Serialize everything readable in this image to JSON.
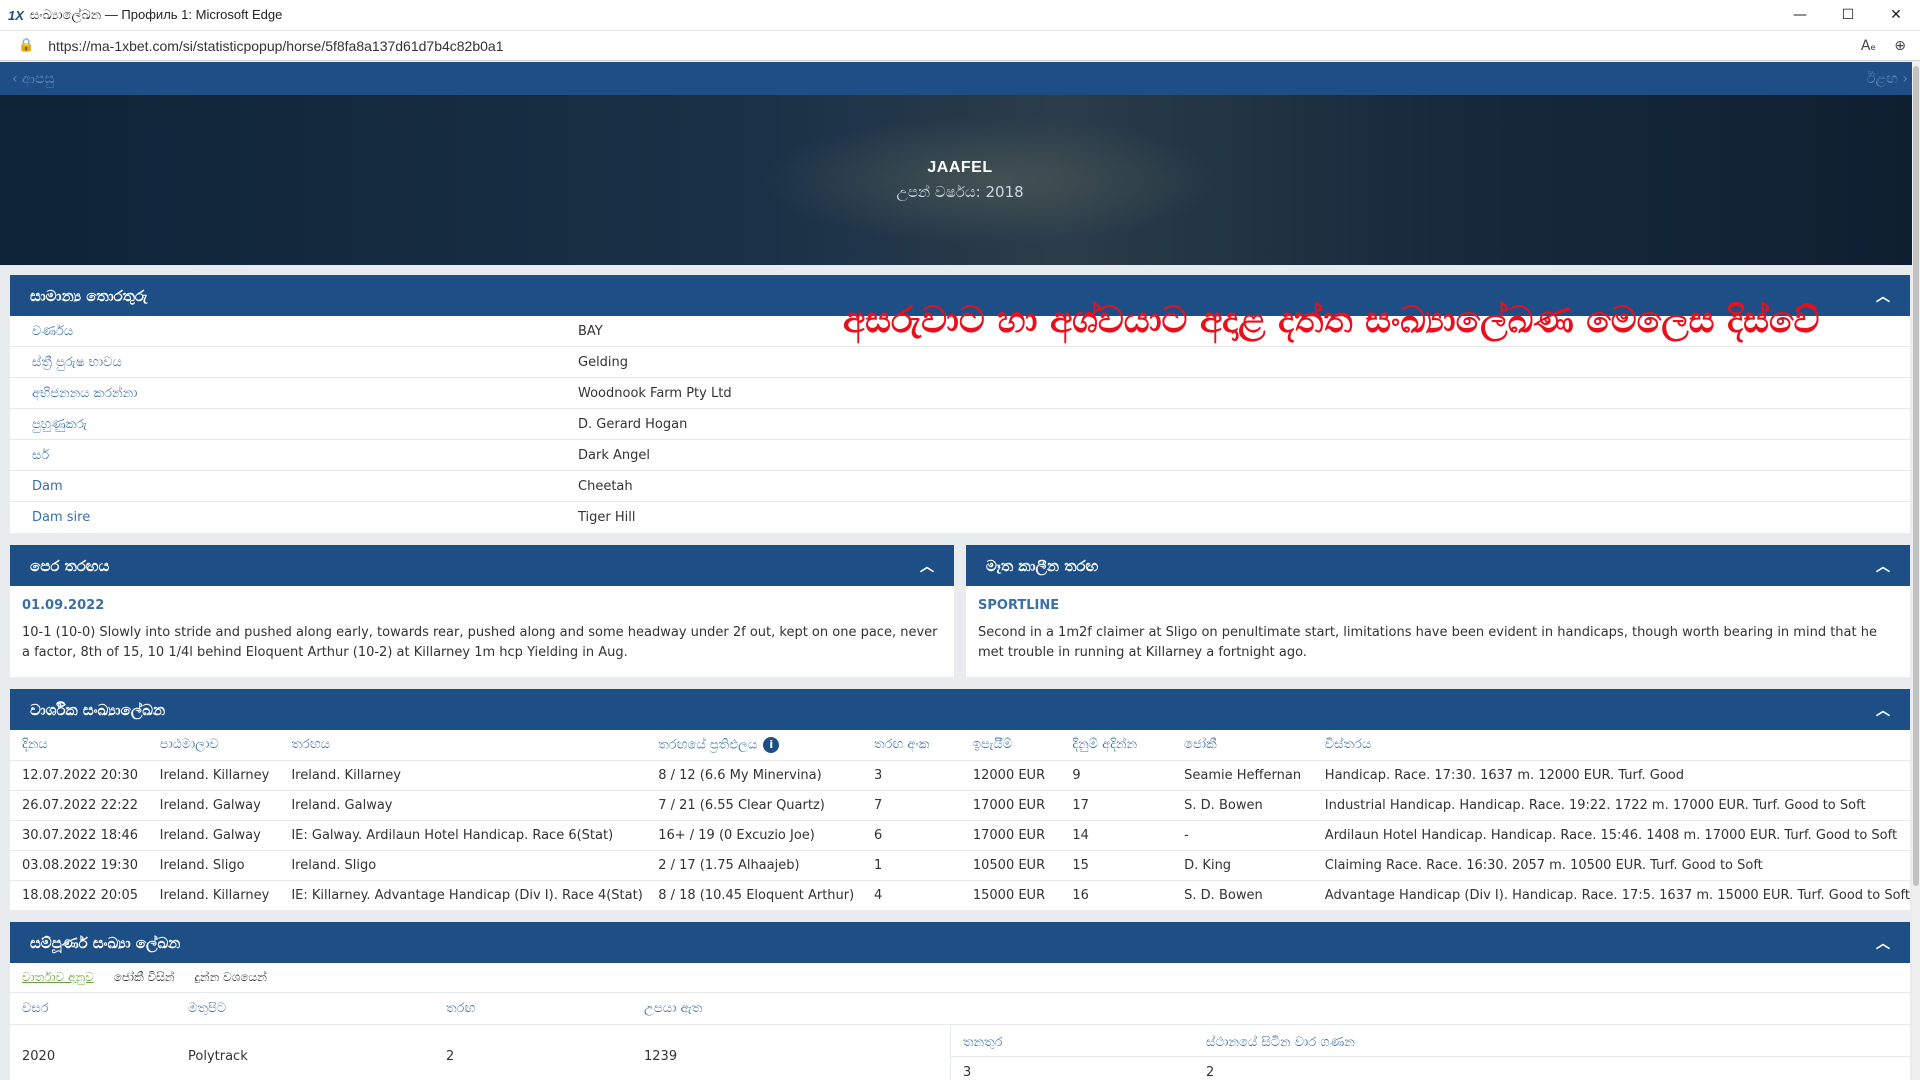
{
  "window": {
    "favicon": "1X",
    "title": "සංඛ්‍යාලේඛන — Профиль 1: Microsoft Edge",
    "controls": {
      "minimize": "—",
      "maximize": "☐",
      "close": "✕"
    }
  },
  "address_bar": {
    "url": "https://ma-1xbet.com/si/statisticpopup/horse/5f8fa8a137d61d7b4c82b0a1",
    "read_aloud": "Aₑ",
    "zoom": "⊕"
  },
  "nav": {
    "back": "‹ ආපසු",
    "forward": "ඊළඟ ›"
  },
  "hero": {
    "horse_name": "JAAFEL",
    "birth_year": "උපන් වර්ෂය: 2018"
  },
  "general": {
    "title": "සාමාන්‍ය තොරතුරු",
    "rows": [
      {
        "key": "වර්ණය",
        "value": "BAY"
      },
      {
        "key": "ස්ත්‍රී පුරුෂ භාවය",
        "value": "Gelding"
      },
      {
        "key": "අභිජනනය කරන්නා",
        "value": "Woodnook Farm Pty Ltd"
      },
      {
        "key": "පුහුණුකරු",
        "value": "D. Gerard Hogan"
      },
      {
        "key": "සර්",
        "value": "Dark Angel"
      },
      {
        "key": "Dam",
        "value": "Cheetah"
      },
      {
        "key": "Dam sire",
        "value": "Tiger Hill"
      }
    ]
  },
  "previous_race": {
    "title": "පෙර තරඟය",
    "date": "01.09.2022",
    "text": "10-1 (10-0) Slowly into stride and pushed along early, towards rear, pushed along and some headway under 2f out, kept on one pace, never a factor, 8th of 15, 10 1/4l behind Eloquent Arthur (10-2) at Killarney 1m hcp Yielding in Aug."
  },
  "recent_races": {
    "title": "මෑත කාලීන තරඟ",
    "source": "SPORTLINE",
    "text": "Second in a 1m2f claimer at Sligo on penultimate start, limitations have been evident in handicaps, though worth bearing in mind that he met trouble in running at Killarney a fortnight ago."
  },
  "annual": {
    "title": "වාර්ශික සංඛ්‍යාලේඛන",
    "headers": [
      "දිනය",
      "පාඨමාලාව",
      "තරඟය",
      "තරඟයේ ප්‍රතිඵලය",
      "තරඟ අංක",
      "ඉපැයීම්",
      "දිනුම් අදින්න",
      "ජෝකී",
      "විස්තරය"
    ],
    "info_icon": "i",
    "rows": [
      [
        "12.07.2022 20:30",
        "Ireland. Killarney",
        "Ireland. Killarney",
        "8 / 12 (6.6 My Minervina)",
        "3",
        "12000 EUR",
        "9",
        "Seamie Heffernan",
        "Handicap. Race. 17:30. 1637 m. 12000 EUR. Turf. Good"
      ],
      [
        "26.07.2022 22:22",
        "Ireland. Galway",
        "Ireland. Galway",
        "7 / 21 (6.55 Clear Quartz)",
        "7",
        "17000 EUR",
        "17",
        "S. D. Bowen",
        "Industrial Handicap. Handicap. Race. 19:22. 1722 m. 17000 EUR. Turf. Good to Soft"
      ],
      [
        "30.07.2022 18:46",
        "Ireland. Galway",
        "IE: Galway. Ardilaun Hotel Handicap. Race 6(Stat)",
        "16+ / 19 (0 Excuzio Joe)",
        "6",
        "17000 EUR",
        "14",
        "-",
        "Ardilaun Hotel Handicap. Handicap. Race. 15:46. 1408 m. 17000 EUR. Turf. Good to Soft"
      ],
      [
        "03.08.2022 19:30",
        "Ireland. Sligo",
        "Ireland. Sligo",
        "2 / 17 (1.75 Alhaajeb)",
        "1",
        "10500 EUR",
        "15",
        "D. King",
        "Claiming Race. Race. 16:30. 2057 m. 10500 EUR. Turf. Good to Soft"
      ],
      [
        "18.08.2022 20:05",
        "Ireland. Killarney",
        "IE: Killarney. Advantage Handicap (Div I). Race 4(Stat)",
        "8 / 18 (10.45 Eloquent Arthur)",
        "4",
        "15000 EUR",
        "16",
        "S. D. Bowen",
        "Advantage Handicap (Div I). Handicap. Race. 17:5. 1637 m. 15000 EUR. Turf. Good to Soft"
      ]
    ]
  },
  "full": {
    "title": "සම්පූර්ණ සංඛ්‍යා ලේඛන",
    "tabs": [
      "වාර්තාව අනුව",
      "ජෝකී විසින්",
      "දුන්න වශයෙන්"
    ],
    "headers": [
      "වසර",
      "මතුපිට",
      "තරඟ",
      "උපයා ඇත"
    ],
    "right_headers": [
      "තනතුර",
      "ස්ථානයේ සිටින වාර ගණන"
    ],
    "row": [
      "2020",
      "Polytrack",
      "2",
      "1239"
    ],
    "right_row": [
      "3",
      "2"
    ]
  },
  "annotation": "අසරුවාට හා අශ්වයාට අදාළ දත්ත සංඛ්‍යාලේඛණ මෙලෙස දිස්වේ",
  "colors": {
    "header_blue": "#1d4f86",
    "link_blue": "#3a6fa8",
    "annotation_red": "#e8101c",
    "active_tab_green": "#6aa33a"
  }
}
